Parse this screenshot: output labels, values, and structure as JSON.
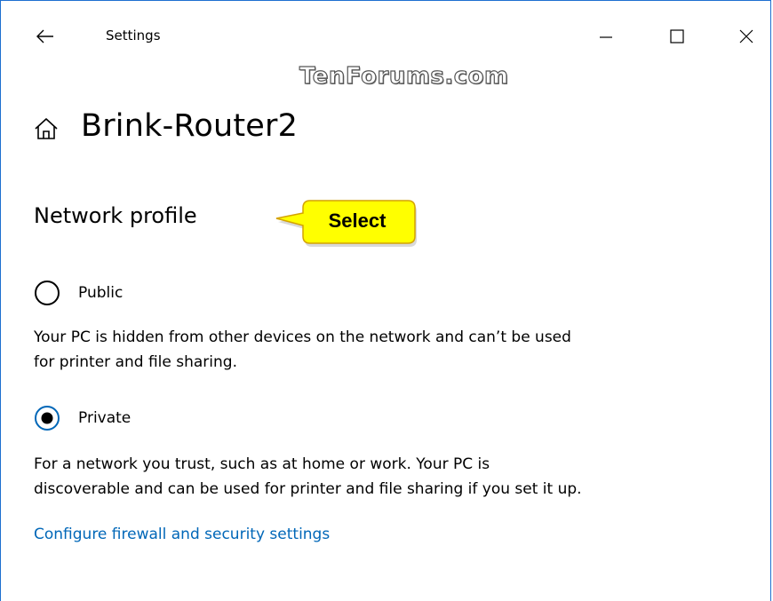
{
  "titlebar": {
    "app_title": "Settings",
    "back_icon": "arrow-left-icon",
    "minimize_icon": "minimize-icon",
    "maximize_icon": "maximize-icon",
    "close_icon": "close-icon"
  },
  "watermark": "TenForums.com",
  "header": {
    "icon": "home-icon",
    "title": "Brink-Router2"
  },
  "network_profile": {
    "section_title": "Network profile",
    "callout_label": "Select",
    "options": [
      {
        "label": "Public",
        "selected": false,
        "description_line1": "Your PC is hidden from other devices on the network and can’t be used",
        "description_line2": "for printer and file sharing."
      },
      {
        "label": "Private",
        "selected": true,
        "description_line1": "For a network you trust, such as at home or work. Your PC is",
        "description_line2": "discoverable and can be used for printer and file sharing if you set it up."
      }
    ]
  },
  "link": {
    "label": "Configure firewall and security settings"
  },
  "colors": {
    "accent": "#0067b8",
    "window_border": "#1e6fd0",
    "callout_fill": "#ffff00",
    "callout_border": "#d4a300"
  }
}
